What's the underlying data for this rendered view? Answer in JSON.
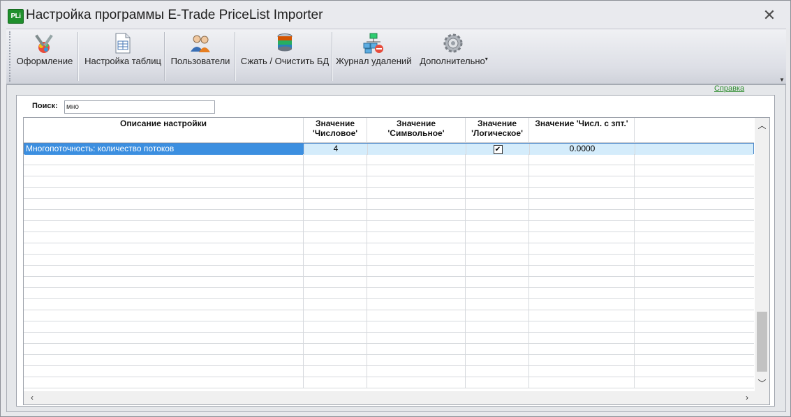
{
  "window": {
    "title": "Настройка программы E-Trade PriceList Importer",
    "app_icon_text": "PLi"
  },
  "toolbar": {
    "items": [
      {
        "label": "Оформление",
        "icon": "design-brush-icon"
      },
      {
        "label": "Настройка таблиц",
        "icon": "table-settings-icon"
      },
      {
        "label": "Пользователи",
        "icon": "users-icon"
      },
      {
        "label": "Сжать / Очистить БД",
        "icon": "database-icon"
      },
      {
        "label": "Журнал удалений",
        "icon": "deletion-log-icon"
      },
      {
        "label": "Дополнительно",
        "icon": "gear-icon"
      }
    ]
  },
  "help_link": "Справка",
  "search": {
    "label": "Поиск:",
    "value": "мно"
  },
  "grid": {
    "columns": [
      "Описание настройки",
      "Значение 'Числовое'",
      "Значение 'Символьное'",
      "Значение 'Логическое'",
      "Значение 'Числ. с зпт.'"
    ],
    "rows": [
      {
        "description": "Многопоточность: количество потоков",
        "numeric": "4",
        "symbolic": "",
        "logical": true,
        "decimal": "0.0000"
      }
    ]
  },
  "colors": {
    "selected_row_bg": "#d4ecfb",
    "selected_cell_bg": "#3c8fe0",
    "help_link": "#2a8a2a"
  }
}
